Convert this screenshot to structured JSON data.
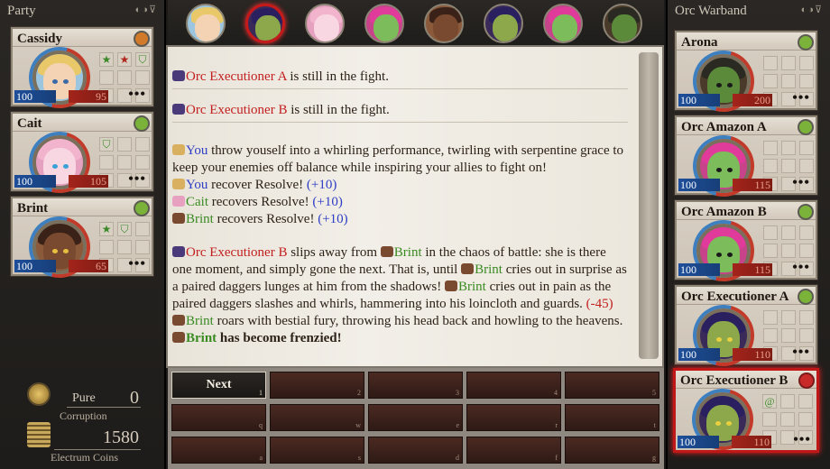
{
  "party": {
    "title": "Party",
    "members": [
      {
        "name": "Cassidy",
        "hp": "100",
        "resolve": "95",
        "more": "•••"
      },
      {
        "name": "Cait",
        "hp": "100",
        "resolve": "105",
        "more": "•••"
      },
      {
        "name": "Brint",
        "hp": "100",
        "resolve": "65",
        "more": "•••"
      }
    ]
  },
  "enemies": {
    "title": "Orc Warband",
    "members": [
      {
        "name": "Arona",
        "hp": "100",
        "resolve": "200",
        "more": "•••"
      },
      {
        "name": "Orc Amazon A",
        "hp": "100",
        "resolve": "115",
        "more": "•••"
      },
      {
        "name": "Orc Amazon B",
        "hp": "100",
        "resolve": "115",
        "more": "•••"
      },
      {
        "name": "Orc Executioner A",
        "hp": "100",
        "resolve": "110",
        "more": "•••"
      },
      {
        "name": "Orc Executioner B",
        "hp": "100",
        "resolve": "110",
        "more": "•••"
      }
    ]
  },
  "stats": {
    "corruption_label": "Pure",
    "corruption_caption": "Corruption",
    "corruption_value": "0",
    "coins_value": "1580",
    "coins_caption": "Electrum Coins"
  },
  "log": {
    "l1_name": "Orc Executioner A",
    "l1_text": " is still in the fight.",
    "l2_name": "Orc Executioner B",
    "l2_text": " is still in the fight.",
    "l3_you": "You",
    "l3_text": " throw youself into a whirling performance, twirling with serpentine grace to keep your enemies off balance while inspiring your allies to fight on!",
    "l4_you": "You",
    "l4_text": " recover Resolve! ",
    "l4_val": "(+10)",
    "l5_name": "Cait",
    "l5_text": " recovers Resolve! ",
    "l5_val": "(+10)",
    "l6_name": "Brint",
    "l6_text": " recovers Resolve! ",
    "l6_val": "(+10)",
    "l7_name": "Orc Executioner B",
    "l7_a": " slips away from ",
    "l7_b": "Brint",
    "l7_c": " in the chaos of battle: she is there one moment, and simply gone the next. That is, until ",
    "l7_d": "Brint",
    "l7_e": " cries out in surprise as a paired daggers lunges at him from the shadows! ",
    "l7_f": "Brint",
    "l7_g": " cries out in pain as the paired daggers slashes and whirls, hammering into his loincloth and guards. ",
    "l7_val": "(-45)",
    "l8_name": "Brint",
    "l8_text": " roars with bestial fury, throwing his head back and howling to the heavens. ",
    "l8_name2": "Brint",
    "l8_text2": " has become frenzied!"
  },
  "actions": {
    "next_label": "Next",
    "keys": [
      "1",
      "2",
      "3",
      "4",
      "5",
      "q",
      "w",
      "e",
      "r",
      "t",
      "a",
      "s",
      "d",
      "f",
      "g"
    ]
  },
  "colors": {
    "enemy": "#c22020",
    "ally": "#3a8a22",
    "value": "#2d3ec4",
    "selected_border": "#c01818"
  }
}
